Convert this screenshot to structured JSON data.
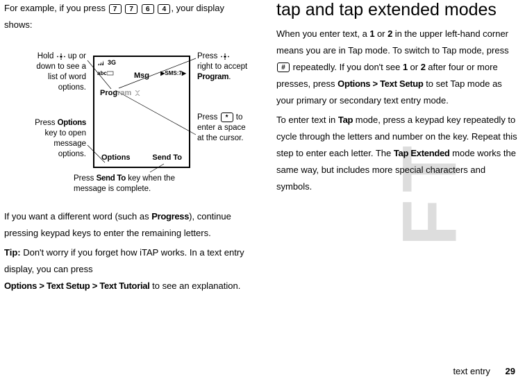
{
  "left": {
    "intro_a": "For example, if you press ",
    "intro_b": ", your display shows:",
    "keys": [
      "7",
      "7",
      "6",
      "4"
    ],
    "diagram": {
      "status": {
        "net": "3G"
      },
      "msg_label": "Msg",
      "abc_label": "abc",
      "sms_label": "SMS:7",
      "typed": "Prog",
      "suggest": "ram",
      "soft_left": "Options",
      "soft_right": "Send To",
      "callouts": {
        "hold": "Hold S up or down to see a list of word options.",
        "press_right": "Press S right to accept Program.",
        "press_star": "Press * to enter a space at the cursor.",
        "press_options": "Press Options key to open message options.",
        "press_sendto": "Press Send To key when the message is complete.",
        "options_bold": "Options",
        "sendto_bold": "Send To",
        "program_bold": "Program"
      }
    },
    "p2a": "If you want a different word (such as ",
    "p2_bold": "Progress",
    "p2b": "), continue pressing keypad keys to enter the remaining letters.",
    "p3a": "Tip:",
    "p3b": " Don't worry if you forget how iTAP works. In a text entry display, you can press ",
    "p3_path": "Options > Text Setup > Text Tutorial",
    "p3c": " to see an explanation."
  },
  "right": {
    "heading": "tap and tap extended modes",
    "p1a": "When you enter text, a ",
    "one": "1",
    "p1b": " or ",
    "two": "2",
    "p1c": " in the upper left-hand corner means you are in Tap mode. To switch to Tap mode, press ",
    "hash": "#",
    "p1d": " repeatedly. If you don't see ",
    "p1e": " after four or more presses, press ",
    "path1": "Options > Text Setup",
    "p1f": " to set Tap mode as your primary or secondary text entry mode.",
    "p2a": "To enter text in ",
    "tap": "Tap",
    "p2b": " mode, press a keypad key repeatedly to cycle through the letters and number on the key. Repeat this step to enter each letter. The ",
    "tapext": "Tap Extended",
    "p2c": " mode works the same way, but includes more special characters and symbols."
  },
  "footer": {
    "section": "text entry",
    "page": "29"
  },
  "watermark": "FT"
}
